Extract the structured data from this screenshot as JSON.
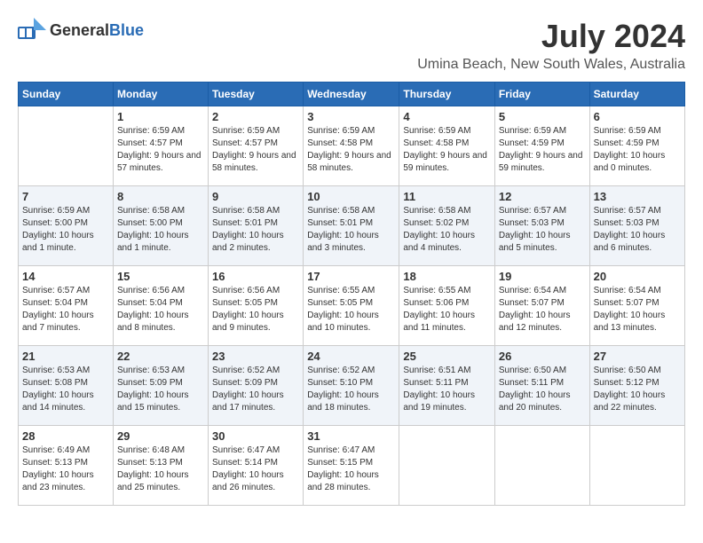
{
  "logo": {
    "general": "General",
    "blue": "Blue"
  },
  "title": {
    "month_year": "July 2024",
    "location": "Umina Beach, New South Wales, Australia"
  },
  "days_of_week": [
    "Sunday",
    "Monday",
    "Tuesday",
    "Wednesday",
    "Thursday",
    "Friday",
    "Saturday"
  ],
  "weeks": [
    [
      {
        "day": "",
        "sunrise": "",
        "sunset": "",
        "daylight": ""
      },
      {
        "day": "1",
        "sunrise": "Sunrise: 6:59 AM",
        "sunset": "Sunset: 4:57 PM",
        "daylight": "Daylight: 9 hours and 57 minutes."
      },
      {
        "day": "2",
        "sunrise": "Sunrise: 6:59 AM",
        "sunset": "Sunset: 4:57 PM",
        "daylight": "Daylight: 9 hours and 58 minutes."
      },
      {
        "day": "3",
        "sunrise": "Sunrise: 6:59 AM",
        "sunset": "Sunset: 4:58 PM",
        "daylight": "Daylight: 9 hours and 58 minutes."
      },
      {
        "day": "4",
        "sunrise": "Sunrise: 6:59 AM",
        "sunset": "Sunset: 4:58 PM",
        "daylight": "Daylight: 9 hours and 59 minutes."
      },
      {
        "day": "5",
        "sunrise": "Sunrise: 6:59 AM",
        "sunset": "Sunset: 4:59 PM",
        "daylight": "Daylight: 9 hours and 59 minutes."
      },
      {
        "day": "6",
        "sunrise": "Sunrise: 6:59 AM",
        "sunset": "Sunset: 4:59 PM",
        "daylight": "Daylight: 10 hours and 0 minutes."
      }
    ],
    [
      {
        "day": "7",
        "sunrise": "Sunrise: 6:59 AM",
        "sunset": "Sunset: 5:00 PM",
        "daylight": "Daylight: 10 hours and 1 minute."
      },
      {
        "day": "8",
        "sunrise": "Sunrise: 6:58 AM",
        "sunset": "Sunset: 5:00 PM",
        "daylight": "Daylight: 10 hours and 1 minute."
      },
      {
        "day": "9",
        "sunrise": "Sunrise: 6:58 AM",
        "sunset": "Sunset: 5:01 PM",
        "daylight": "Daylight: 10 hours and 2 minutes."
      },
      {
        "day": "10",
        "sunrise": "Sunrise: 6:58 AM",
        "sunset": "Sunset: 5:01 PM",
        "daylight": "Daylight: 10 hours and 3 minutes."
      },
      {
        "day": "11",
        "sunrise": "Sunrise: 6:58 AM",
        "sunset": "Sunset: 5:02 PM",
        "daylight": "Daylight: 10 hours and 4 minutes."
      },
      {
        "day": "12",
        "sunrise": "Sunrise: 6:57 AM",
        "sunset": "Sunset: 5:03 PM",
        "daylight": "Daylight: 10 hours and 5 minutes."
      },
      {
        "day": "13",
        "sunrise": "Sunrise: 6:57 AM",
        "sunset": "Sunset: 5:03 PM",
        "daylight": "Daylight: 10 hours and 6 minutes."
      }
    ],
    [
      {
        "day": "14",
        "sunrise": "Sunrise: 6:57 AM",
        "sunset": "Sunset: 5:04 PM",
        "daylight": "Daylight: 10 hours and 7 minutes."
      },
      {
        "day": "15",
        "sunrise": "Sunrise: 6:56 AM",
        "sunset": "Sunset: 5:04 PM",
        "daylight": "Daylight: 10 hours and 8 minutes."
      },
      {
        "day": "16",
        "sunrise": "Sunrise: 6:56 AM",
        "sunset": "Sunset: 5:05 PM",
        "daylight": "Daylight: 10 hours and 9 minutes."
      },
      {
        "day": "17",
        "sunrise": "Sunrise: 6:55 AM",
        "sunset": "Sunset: 5:05 PM",
        "daylight": "Daylight: 10 hours and 10 minutes."
      },
      {
        "day": "18",
        "sunrise": "Sunrise: 6:55 AM",
        "sunset": "Sunset: 5:06 PM",
        "daylight": "Daylight: 10 hours and 11 minutes."
      },
      {
        "day": "19",
        "sunrise": "Sunrise: 6:54 AM",
        "sunset": "Sunset: 5:07 PM",
        "daylight": "Daylight: 10 hours and 12 minutes."
      },
      {
        "day": "20",
        "sunrise": "Sunrise: 6:54 AM",
        "sunset": "Sunset: 5:07 PM",
        "daylight": "Daylight: 10 hours and 13 minutes."
      }
    ],
    [
      {
        "day": "21",
        "sunrise": "Sunrise: 6:53 AM",
        "sunset": "Sunset: 5:08 PM",
        "daylight": "Daylight: 10 hours and 14 minutes."
      },
      {
        "day": "22",
        "sunrise": "Sunrise: 6:53 AM",
        "sunset": "Sunset: 5:09 PM",
        "daylight": "Daylight: 10 hours and 15 minutes."
      },
      {
        "day": "23",
        "sunrise": "Sunrise: 6:52 AM",
        "sunset": "Sunset: 5:09 PM",
        "daylight": "Daylight: 10 hours and 17 minutes."
      },
      {
        "day": "24",
        "sunrise": "Sunrise: 6:52 AM",
        "sunset": "Sunset: 5:10 PM",
        "daylight": "Daylight: 10 hours and 18 minutes."
      },
      {
        "day": "25",
        "sunrise": "Sunrise: 6:51 AM",
        "sunset": "Sunset: 5:11 PM",
        "daylight": "Daylight: 10 hours and 19 minutes."
      },
      {
        "day": "26",
        "sunrise": "Sunrise: 6:50 AM",
        "sunset": "Sunset: 5:11 PM",
        "daylight": "Daylight: 10 hours and 20 minutes."
      },
      {
        "day": "27",
        "sunrise": "Sunrise: 6:50 AM",
        "sunset": "Sunset: 5:12 PM",
        "daylight": "Daylight: 10 hours and 22 minutes."
      }
    ],
    [
      {
        "day": "28",
        "sunrise": "Sunrise: 6:49 AM",
        "sunset": "Sunset: 5:13 PM",
        "daylight": "Daylight: 10 hours and 23 minutes."
      },
      {
        "day": "29",
        "sunrise": "Sunrise: 6:48 AM",
        "sunset": "Sunset: 5:13 PM",
        "daylight": "Daylight: 10 hours and 25 minutes."
      },
      {
        "day": "30",
        "sunrise": "Sunrise: 6:47 AM",
        "sunset": "Sunset: 5:14 PM",
        "daylight": "Daylight: 10 hours and 26 minutes."
      },
      {
        "day": "31",
        "sunrise": "Sunrise: 6:47 AM",
        "sunset": "Sunset: 5:15 PM",
        "daylight": "Daylight: 10 hours and 28 minutes."
      },
      {
        "day": "",
        "sunrise": "",
        "sunset": "",
        "daylight": ""
      },
      {
        "day": "",
        "sunrise": "",
        "sunset": "",
        "daylight": ""
      },
      {
        "day": "",
        "sunrise": "",
        "sunset": "",
        "daylight": ""
      }
    ]
  ]
}
